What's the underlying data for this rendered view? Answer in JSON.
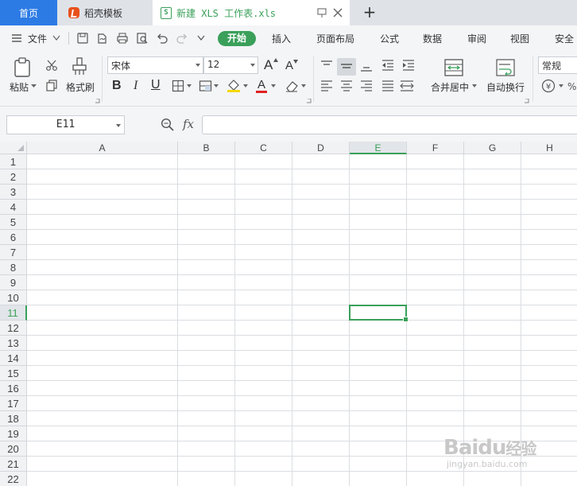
{
  "tabs": {
    "home": "首页",
    "template": "稻壳模板",
    "doc": "新建 XLS 工作表.xls",
    "doc_icon": "S"
  },
  "menu": {
    "file": "文件",
    "items": [
      "开始",
      "插入",
      "页面布局",
      "公式",
      "数据",
      "审阅",
      "视图",
      "安全"
    ]
  },
  "ribbon": {
    "paste": "粘贴",
    "format_painter": "格式刷",
    "font_name": "宋体",
    "font_size": "12",
    "merge_center": "合并居中",
    "wrap_text": "自动换行",
    "number_format": "常规",
    "bold": "B",
    "italic": "I",
    "underline": "U",
    "grow_font": "A",
    "shrink_font": "A",
    "font_color_glyph": "A"
  },
  "formula_bar": {
    "cell_ref": "E11",
    "fx": "fx",
    "value": ""
  },
  "grid": {
    "columns": [
      "A",
      "B",
      "C",
      "D",
      "E",
      "F",
      "G",
      "H"
    ],
    "rows": [
      "1",
      "2",
      "3",
      "4",
      "5",
      "6",
      "7",
      "8",
      "9",
      "10",
      "11",
      "12",
      "13",
      "14",
      "15",
      "16",
      "17",
      "18",
      "19",
      "20",
      "21",
      "22"
    ],
    "selected_column": "E",
    "selected_row": "11"
  },
  "watermark": {
    "brand": "Baidu",
    "brand_cn": "经验",
    "url": "jingyan.baidu.com"
  },
  "colors": {
    "accent": "#3aa05a",
    "home_tab": "#2c7be5",
    "dk_logo": "#e8501c",
    "font_color_bar": "#e02020",
    "fill_color_bar": "#f5d800"
  }
}
